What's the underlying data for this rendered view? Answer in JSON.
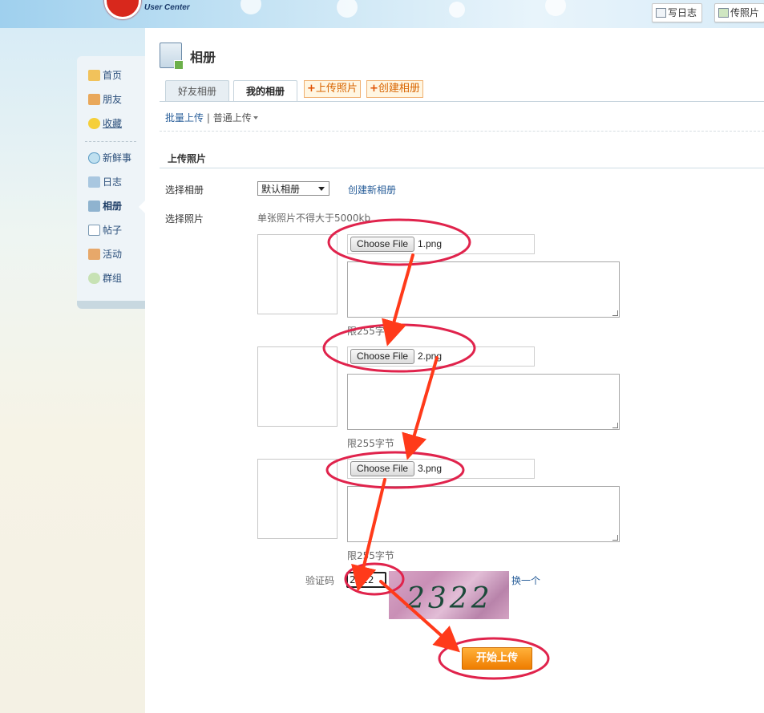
{
  "header": {
    "logo_subtitle": "User Center",
    "write_blog_label": "写日志",
    "upload_photo_label": "传照片"
  },
  "sidebar": {
    "items": [
      {
        "label": "首页",
        "icon": "home-icon"
      },
      {
        "label": "朋友",
        "icon": "friends-icon"
      },
      {
        "label": "收藏",
        "icon": "star-icon"
      },
      {
        "label": "新鲜事",
        "icon": "speech-bubble-icon"
      },
      {
        "label": "日志",
        "icon": "blog-icon"
      },
      {
        "label": "相册",
        "icon": "album-icon"
      },
      {
        "label": "帖子",
        "icon": "document-icon"
      },
      {
        "label": "活动",
        "icon": "people-icon"
      },
      {
        "label": "群组",
        "icon": "group-chat-icon"
      }
    ],
    "active": "相册"
  },
  "main": {
    "title": "相册",
    "tabs": [
      {
        "label": "好友相册"
      },
      {
        "label": "我的相册"
      }
    ],
    "actions": {
      "upload_photo": "上传照片",
      "create_album": "创建相册"
    },
    "subnav": {
      "batch_upload": "批量上传",
      "separator": "|",
      "normal_upload": "普通上传"
    },
    "section_title": "上传照片",
    "form": {
      "album_label": "选择相册",
      "album_selected": "默认相册",
      "create_new_album": "创建新相册",
      "photo_label": "选择照片",
      "size_hint": "单张照片不得大于5000kb",
      "choose_file_label": "Choose File",
      "files": [
        {
          "name": "1.png",
          "limit": "限255字节"
        },
        {
          "name": "2.png",
          "limit": "限255字节"
        },
        {
          "name": "3.png",
          "limit": "限255字节"
        }
      ],
      "captcha_label": "验证码",
      "captcha_value": "2322",
      "captcha_image_text": "2322",
      "captcha_refresh": "换一个",
      "submit_label": "开始上传"
    }
  },
  "colors": {
    "annotation_ellipse": "#e0234c",
    "annotation_arrow": "#ff3a1a",
    "submit_orange": "#ef7d00",
    "link_blue": "#2a5f9a"
  }
}
